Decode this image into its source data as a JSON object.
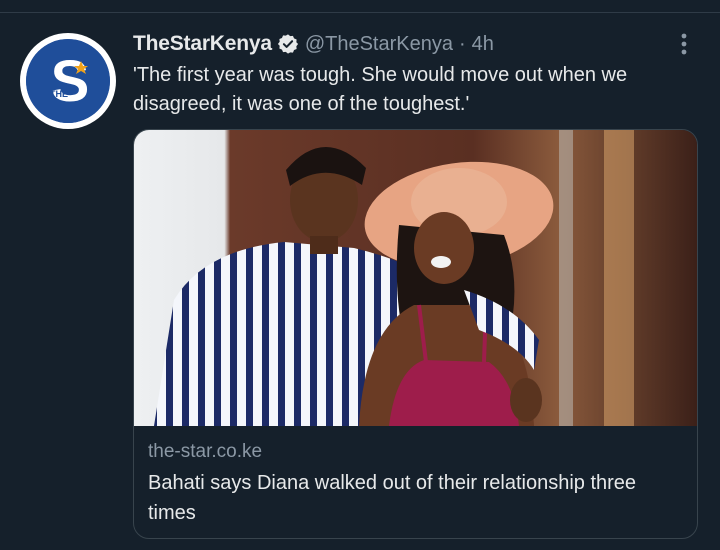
{
  "tweet": {
    "author_name": "TheStarKenya",
    "handle": "@TheStarKenya",
    "separator": "·",
    "time_ago": "4h",
    "text": "'The first year was tough. She would move out when we disagreed, it was one of the toughest.'",
    "avatar_logo_letter": "S",
    "avatar_logo_small": "THE",
    "verified": true
  },
  "link_card": {
    "domain": "the-star.co.ke",
    "title": "Bahati says Diana walked out of their relationship three times",
    "image_description": "photo"
  },
  "icons": {
    "verified": "verified-badge-icon",
    "more": "more-vertical-icon"
  },
  "colors": {
    "background": "#15202b",
    "primary_text": "#e7e9ea",
    "secondary_text": "#8b98a5",
    "border": "#38444d",
    "avatar_blue": "#1f4e9a"
  }
}
